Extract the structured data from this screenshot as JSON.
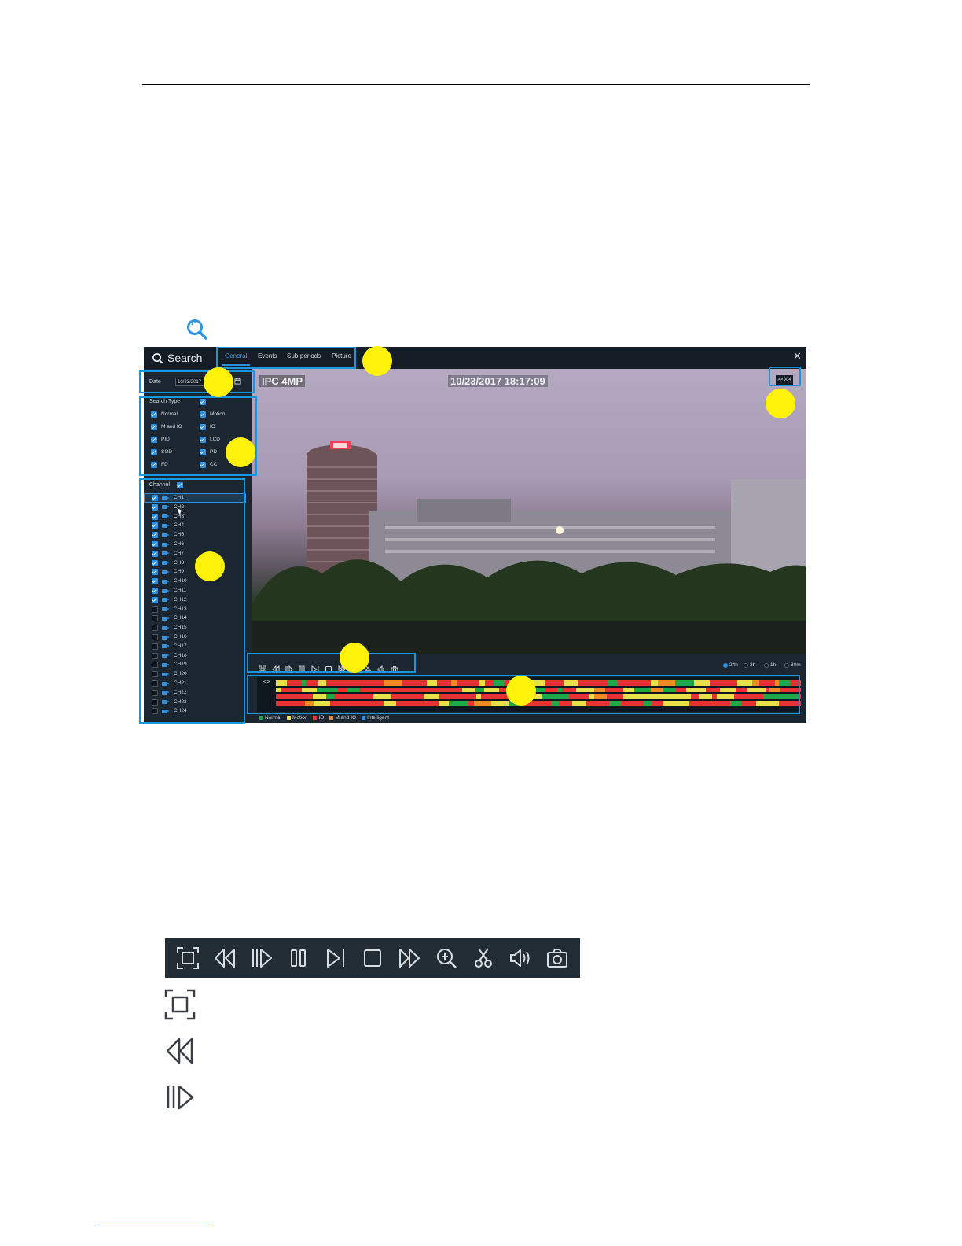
{
  "window": {
    "title": "Search",
    "tabs": [
      "General",
      "Events",
      "Sub-periods",
      "Picture"
    ],
    "active_tab": "General",
    "close": "✕"
  },
  "sidebar": {
    "date_label": "Date",
    "date_value": "10/23/2017",
    "search_type_label": "Search Type",
    "search_types": [
      {
        "label": "Normal",
        "checked": true
      },
      {
        "label": "Motion",
        "checked": true
      },
      {
        "label": "M and IO",
        "checked": true
      },
      {
        "label": "IO",
        "checked": true
      },
      {
        "label": "PID",
        "checked": true
      },
      {
        "label": "LCD",
        "checked": true
      },
      {
        "label": "SOD",
        "checked": true
      },
      {
        "label": "PD",
        "checked": true
      },
      {
        "label": "FD",
        "checked": true
      },
      {
        "label": "CC",
        "checked": true
      }
    ],
    "channel_label": "Channel",
    "channels": [
      {
        "label": "CH1",
        "checked": true
      },
      {
        "label": "CH2",
        "checked": true
      },
      {
        "label": "CH3",
        "checked": true
      },
      {
        "label": "CH4",
        "checked": true
      },
      {
        "label": "CH5",
        "checked": true
      },
      {
        "label": "CH6",
        "checked": true
      },
      {
        "label": "CH7",
        "checked": true
      },
      {
        "label": "CH8",
        "checked": true
      },
      {
        "label": "CH9",
        "checked": true
      },
      {
        "label": "CH10",
        "checked": true
      },
      {
        "label": "CH11",
        "checked": true
      },
      {
        "label": "CH12",
        "checked": true
      },
      {
        "label": "CH13",
        "checked": false
      },
      {
        "label": "CH14",
        "checked": false
      },
      {
        "label": "CH15",
        "checked": false
      },
      {
        "label": "CH16",
        "checked": false
      },
      {
        "label": "CH17",
        "checked": false
      },
      {
        "label": "CH18",
        "checked": false
      },
      {
        "label": "CH19",
        "checked": false
      },
      {
        "label": "CH20",
        "checked": false
      },
      {
        "label": "CH21",
        "checked": false
      },
      {
        "label": "CH22",
        "checked": false
      },
      {
        "label": "CH23",
        "checked": false
      },
      {
        "label": "CH24",
        "checked": false
      }
    ]
  },
  "video": {
    "camera_label": "IPC 4MP",
    "timestamp": "10/23/2017 18:17:09",
    "speed": ">> X 4"
  },
  "controls": {
    "buttons": [
      "fullscreen-icon",
      "rewind-icon",
      "slow-play-icon",
      "pause-icon",
      "step-forward-icon",
      "stop-icon",
      "fast-forward-icon",
      "zoom-in-icon",
      "clip-icon",
      "volume-icon",
      "snapshot-icon"
    ],
    "time_scales": [
      "24h",
      "2h",
      "1h",
      "30m"
    ],
    "selected_scale": "24h"
  },
  "timeline": {
    "arrow": "<>",
    "legend": [
      {
        "label": "Normal",
        "color": "#1fa84a"
      },
      {
        "label": "Motion",
        "color": "#e8e04a"
      },
      {
        "label": "IO",
        "color": "#e63232"
      },
      {
        "label": "M and IO",
        "color": "#f08a24"
      },
      {
        "label": "Intelligent",
        "color": "#2d8fe0"
      }
    ]
  },
  "colors": {
    "highlight": "#1797e0",
    "callout": "#fef20a",
    "accent": "#2d8fe0"
  }
}
